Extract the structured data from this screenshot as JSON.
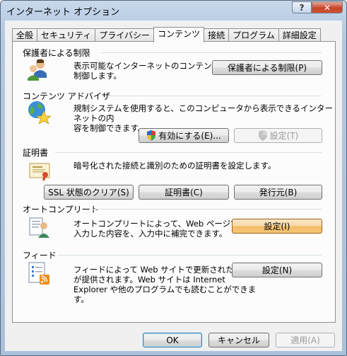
{
  "window": {
    "title": "インターネット オプション",
    "help_label": "?",
    "close_label": "✕"
  },
  "tabs": [
    "全般",
    "セキュリティ",
    "プライバシー",
    "コンテンツ",
    "接続",
    "プログラム",
    "詳細設定"
  ],
  "active_tab_index": 3,
  "sections": {
    "parental": {
      "title": "保護者による制限",
      "description_lines": [
        "表示可能なインターネットのコンテンツを",
        "制御します。"
      ],
      "button_label": "保護者による制限(P)",
      "icon": "parental-controls-icon"
    },
    "advisor": {
      "title": "コンテンツ アドバイザ",
      "description_lines": [
        "規制システムを使用すると、このコンピュータから表示できるインターネットの内",
        "容を制御できます。"
      ],
      "enable_label": "有効にする(E)...",
      "settings_label": "設定(T)",
      "icon": "globe-star-icon"
    },
    "certificates": {
      "title": "証明書",
      "description": "暗号化された接続と識別のための証明書を設定します。",
      "ssl_label": "SSL 状態のクリア(S)",
      "certs_label": "証明書(C)",
      "publishers_label": "発行元(B)",
      "icon": "certificate-icon"
    },
    "autocomplete": {
      "title": "オートコンプリート",
      "description_lines": [
        "オートコンプリートによって、Web ページで前回",
        "入力した内容を、入力中に補完できます。"
      ],
      "settings_label": "設定(I)",
      "icon": "autocomplete-user-icon"
    },
    "feeds": {
      "title": "フィード",
      "description_lines": [
        "フィードによって Web サイトで更新された内容",
        "が提供されます。Web サイトは Internet",
        "Explorer や他のプログラムでも読むことができま",
        "す。"
      ],
      "settings_label": "設定(N)",
      "icon": "feed-icon"
    }
  },
  "footer": {
    "ok_label": "OK",
    "cancel_label": "キャンセル",
    "apply_label": "適用(A)"
  },
  "colors": {
    "accent_hot_button": "#f6c775",
    "title_bar": "#b9cde4",
    "close_button": "#c6462c",
    "feed_orange": "#f08a1c"
  }
}
